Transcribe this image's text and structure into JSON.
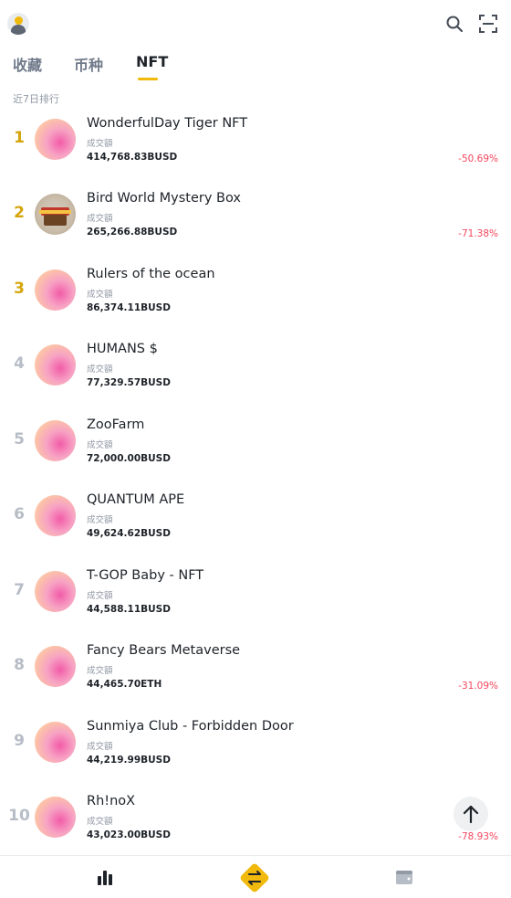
{
  "tabs": [
    {
      "label": "收藏"
    },
    {
      "label": "币种"
    },
    {
      "label": "NFT"
    }
  ],
  "active_tab": "NFT",
  "section_label": "近7日排行",
  "items": [
    {
      "rank": "1",
      "name": "WonderfulDay Tiger NFT",
      "vol_label": "成交額",
      "volume": "414,768.83BUSD",
      "change": "-50.69%"
    },
    {
      "rank": "2",
      "name": "Bird World Mystery Box",
      "vol_label": "成交額",
      "volume": "265,266.88BUSD",
      "change": "-71.38%"
    },
    {
      "rank": "3",
      "name": "Rulers of the ocean",
      "vol_label": "成交額",
      "volume": "86,374.11BUSD",
      "change": ""
    },
    {
      "rank": "4",
      "name": "HUMANS $",
      "vol_label": "成交額",
      "volume": "77,329.57BUSD",
      "change": ""
    },
    {
      "rank": "5",
      "name": "ZooFarm",
      "vol_label": "成交額",
      "volume": "72,000.00BUSD",
      "change": ""
    },
    {
      "rank": "6",
      "name": "QUANTUM APE",
      "vol_label": "成交額",
      "volume": "49,624.62BUSD",
      "change": ""
    },
    {
      "rank": "7",
      "name": "T-GOP Baby - NFT",
      "vol_label": "成交額",
      "volume": "44,588.11BUSD",
      "change": ""
    },
    {
      "rank": "8",
      "name": "Fancy Bears Metaverse",
      "vol_label": "成交額",
      "volume": "44,465.70ETH",
      "change": "-31.09%"
    },
    {
      "rank": "9",
      "name": "Sunmiya Club - Forbidden Door",
      "vol_label": "成交額",
      "volume": "44,219.99BUSD",
      "change": ""
    },
    {
      "rank": "10",
      "name": "Rh!noX",
      "vol_label": "成交額",
      "volume": "43,023.00BUSD",
      "change": "-78.93%"
    }
  ],
  "colors": {
    "accent": "#f0b90b",
    "negative": "#f6465d",
    "text_primary": "#1e2329",
    "text_secondary": "#929aa5"
  },
  "icons": {
    "top_left": "avatar",
    "top_right": [
      "search-icon",
      "scan-icon"
    ],
    "scroll": "arrow-up-icon",
    "bottom_nav": [
      "markets-bar-chart-icon",
      "trade-swap-icon",
      "wallet-icon"
    ]
  }
}
